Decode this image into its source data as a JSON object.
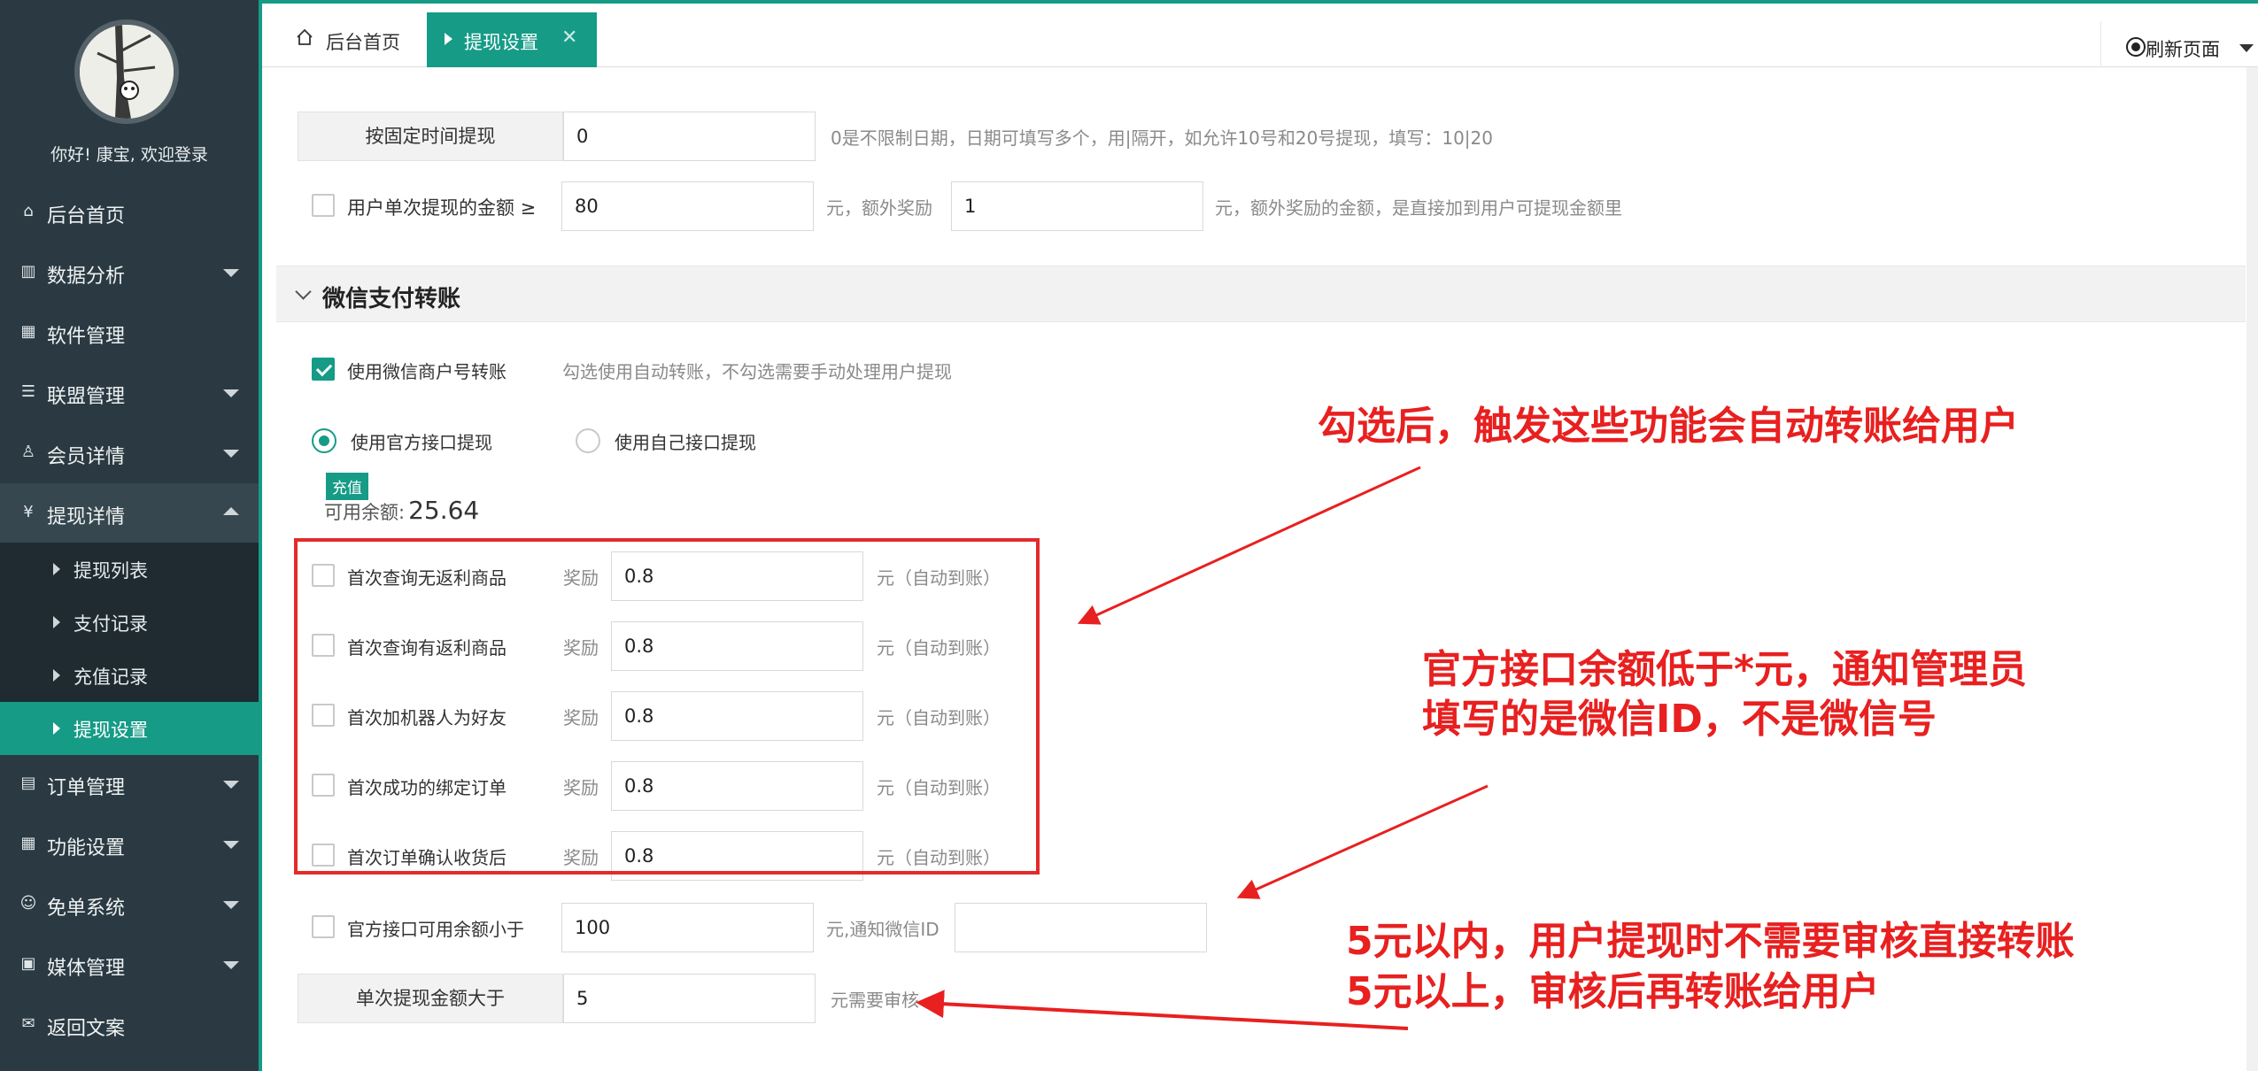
{
  "sidebar": {
    "welcome": "你好! 康宝, 欢迎登录",
    "items": [
      {
        "label": "后台首页",
        "icon": "home-icon",
        "glyph": "⌂"
      },
      {
        "label": "数据分析",
        "icon": "analytics-icon",
        "glyph": "▥"
      },
      {
        "label": "软件管理",
        "icon": "apps-icon",
        "glyph": "▦"
      },
      {
        "label": "联盟管理",
        "icon": "list-icon",
        "glyph": "☰"
      },
      {
        "label": "会员详情",
        "icon": "user-icon",
        "glyph": "♙"
      },
      {
        "label": "提现详情",
        "icon": "yen-icon",
        "glyph": "¥"
      },
      {
        "label": "订单管理",
        "icon": "grid-icon",
        "glyph": "▤"
      },
      {
        "label": "功能设置",
        "icon": "apps-icon",
        "glyph": "▦"
      },
      {
        "label": "免单系统",
        "icon": "smile-icon",
        "glyph": "☺"
      },
      {
        "label": "媒体管理",
        "icon": "image-icon",
        "glyph": "▣"
      },
      {
        "label": "返回文案",
        "icon": "chat-icon",
        "glyph": "✉"
      }
    ],
    "subitems": [
      "提现列表",
      "支付记录",
      "充值记录",
      "提现设置"
    ]
  },
  "tabs": {
    "home": "后台首页",
    "active": "提现设置",
    "close": "✕",
    "refresh": "刷新页面"
  },
  "form": {
    "fixed_time": {
      "label": "按固定时间提现",
      "value": "0",
      "hint": "0是不限制日期，日期可填写多个，用|隔开，如允许10号和20号提现，填写：10|20"
    },
    "bonus": {
      "label": "用户单次提现的金额 ≥",
      "value": "80",
      "mid": "元，额外奖励",
      "value2": "1",
      "hint": "元，额外奖励的金额，是直接加到用户可提现金额里"
    },
    "section_title": "微信支付转账",
    "use_merchant": {
      "label": "使用微信商户号转账",
      "hint": "勾选使用自动转账，不勾选需要手动处理用户提现"
    },
    "radio_official": "使用官方接口提现",
    "radio_own": "使用自己接口提现",
    "recharge_badge": "充值",
    "balance_label": "可用余额:",
    "balance_value": "25.64",
    "rewards": [
      {
        "label": "首次查询无返利商品",
        "prefix": "奖励",
        "value": "0.8",
        "suffix": "元（自动到账）"
      },
      {
        "label": "首次查询有返利商品",
        "prefix": "奖励",
        "value": "0.8",
        "suffix": "元（自动到账）"
      },
      {
        "label": "首次加机器人为好友",
        "prefix": "奖励",
        "value": "0.8",
        "suffix": "元（自动到账）"
      },
      {
        "label": "首次成功的绑定订单",
        "prefix": "奖励",
        "value": "0.8",
        "suffix": "元（自动到账）"
      },
      {
        "label": "首次订单确认收货后",
        "prefix": "奖励",
        "value": "0.8",
        "suffix": "元（自动到账）"
      }
    ],
    "low_balance": {
      "label": "官方接口可用余额小于",
      "value": "100",
      "hint": "元,通知微信ID",
      "value2": ""
    },
    "review": {
      "label": "单次提现金额大于",
      "value": "5",
      "hint": "元需要审核"
    }
  },
  "annotations": {
    "a1": "勾选后，触发这些功能会自动转账给用户",
    "a2_line1": "官方接口余额低于*元，通知管理员",
    "a2_line2": "填写的是微信ID，不是微信号",
    "a3_line1": "5元以内，用户提现时不需要审核直接转账",
    "a3_line2": "5元以上，审核后再转账给用户"
  },
  "colors": {
    "accent": "#169b87",
    "sidebar": "#2b3a42",
    "annotation": "#e82020"
  }
}
